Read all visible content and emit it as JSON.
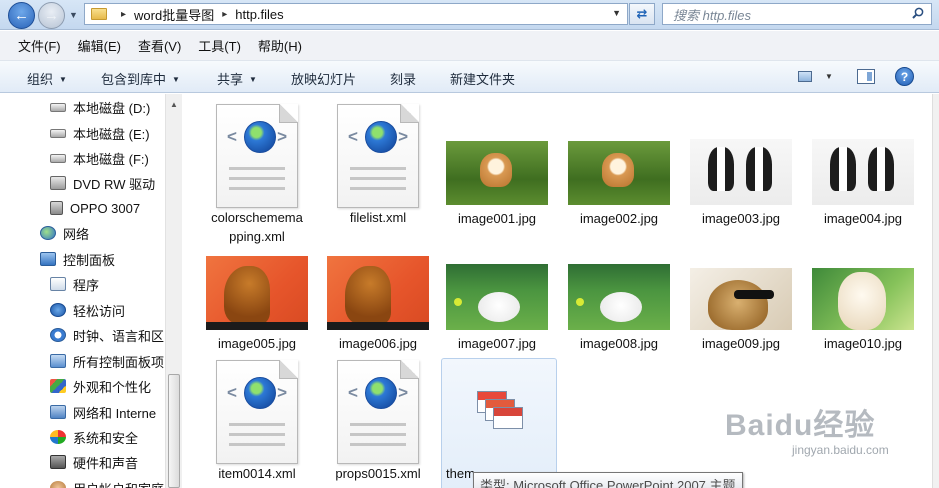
{
  "address_bar": {
    "path": [
      "word批量导图",
      "http.files"
    ],
    "search_placeholder": "搜索 http.files"
  },
  "menu": [
    "文件(F)",
    "编辑(E)",
    "查看(V)",
    "工具(T)",
    "帮助(H)"
  ],
  "toolbar": {
    "organize": "组织",
    "include_library": "包含到库中",
    "share": "共享",
    "slideshow": "放映幻灯片",
    "burn": "刻录",
    "new_folder": "新建文件夹"
  },
  "sidebar": {
    "items": [
      {
        "label": "本地磁盘 (D:)",
        "icon": "drive-icon"
      },
      {
        "label": "本地磁盘 (E:)",
        "icon": "drive-icon"
      },
      {
        "label": "本地磁盘 (F:)",
        "icon": "drive-icon"
      },
      {
        "label": "DVD RW 驱动",
        "icon": "dvd-drive-icon"
      },
      {
        "label": "OPPO 3007",
        "icon": "phone-icon"
      },
      {
        "label": "网络",
        "icon": "network-icon"
      },
      {
        "label": "控制面板",
        "icon": "control-panel-icon"
      },
      {
        "label": "程序",
        "icon": "programs-icon"
      },
      {
        "label": "轻松访问",
        "icon": "ease-of-access-icon"
      },
      {
        "label": "时钟、语言和区",
        "icon": "clock-icon"
      },
      {
        "label": "所有控制面板项",
        "icon": "all-items-icon"
      },
      {
        "label": "外观和个性化",
        "icon": "appearance-icon"
      },
      {
        "label": "网络和 Interne",
        "icon": "network-internet-icon"
      },
      {
        "label": "系统和安全",
        "icon": "security-icon"
      },
      {
        "label": "硬件和声音",
        "icon": "hardware-icon"
      },
      {
        "label": "用户帐户和家庭",
        "icon": "user-accounts-icon"
      }
    ]
  },
  "files": {
    "row1": [
      {
        "name": "colorschememapping.xml",
        "display": [
          "colorschemema",
          "pping.xml"
        ],
        "kind": "xml"
      },
      {
        "name": "filelist.xml",
        "display": [
          "filelist.xml"
        ],
        "kind": "xml"
      },
      {
        "name": "image001.jpg",
        "display": [
          "image001.jpg"
        ],
        "kind": "corgi"
      },
      {
        "name": "image002.jpg",
        "display": [
          "image002.jpg"
        ],
        "kind": "corgi"
      },
      {
        "name": "image003.jpg",
        "display": [
          "image003.jpg"
        ],
        "kind": "boston"
      },
      {
        "name": "image004.jpg",
        "display": [
          "image004.jpg"
        ],
        "kind": "boston"
      }
    ],
    "row2": [
      {
        "name": "image005.jpg",
        "kind": "golden"
      },
      {
        "name": "image006.jpg",
        "kind": "golden"
      },
      {
        "name": "image007.jpg",
        "kind": "white"
      },
      {
        "name": "image008.jpg",
        "kind": "white"
      },
      {
        "name": "image009.jpg",
        "kind": "labglass"
      },
      {
        "name": "image010.jpg",
        "kind": "puppy"
      }
    ],
    "row3": [
      {
        "name": "item0014.xml",
        "kind": "xml"
      },
      {
        "name": "props0015.xml",
        "kind": "xml"
      }
    ],
    "selected_partial_label": "them"
  },
  "tooltip": "类型: Microsoft Office PowerPoint 2007 主题",
  "watermark": {
    "brand": "Baidu经验",
    "url": "jingyan.baidu.com"
  }
}
